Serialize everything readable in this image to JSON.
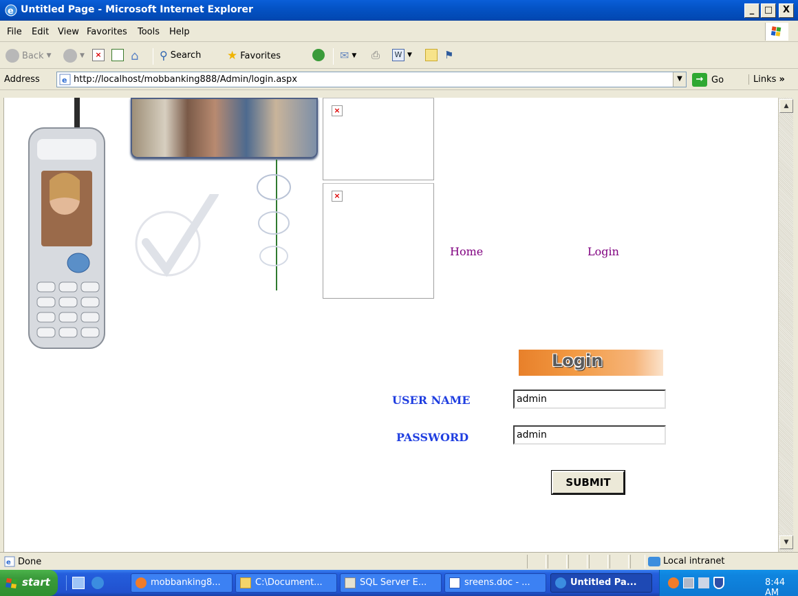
{
  "window": {
    "title": "Untitled Page - Microsoft Internet Explorer",
    "buttons": [
      "_",
      "□",
      "X"
    ]
  },
  "menu": [
    "File",
    "Edit",
    "View",
    "Favorites",
    "Tools",
    "Help"
  ],
  "toolbar": {
    "back": "Back",
    "search": "Search",
    "favorites": "Favorites"
  },
  "address": {
    "label": "Address",
    "url": "http://localhost/mobbanking888/Admin/login.aspx",
    "go": "Go",
    "links": "Links"
  },
  "page": {
    "nav": [
      "Home",
      "Login"
    ],
    "login_banner": "Login",
    "username_label": "USER NAME",
    "username_value": "admin",
    "password_label": "PASSWORD",
    "password_value": "admin",
    "submit": "SUBMIT"
  },
  "status": {
    "text": "Done",
    "zone": "Local intranet"
  },
  "taskbar": {
    "start": "start",
    "items": [
      "mobbanking8...",
      "C:\\Document...",
      "SQL Server E...",
      "sreens.doc - ...",
      "Untitled Pa..."
    ],
    "clock": "8:44 AM"
  },
  "colors": {
    "nav_link": "#800080",
    "field_label": "#1f3ee0",
    "login_banner": "#e8802a",
    "titlebar": "#0453c6"
  }
}
